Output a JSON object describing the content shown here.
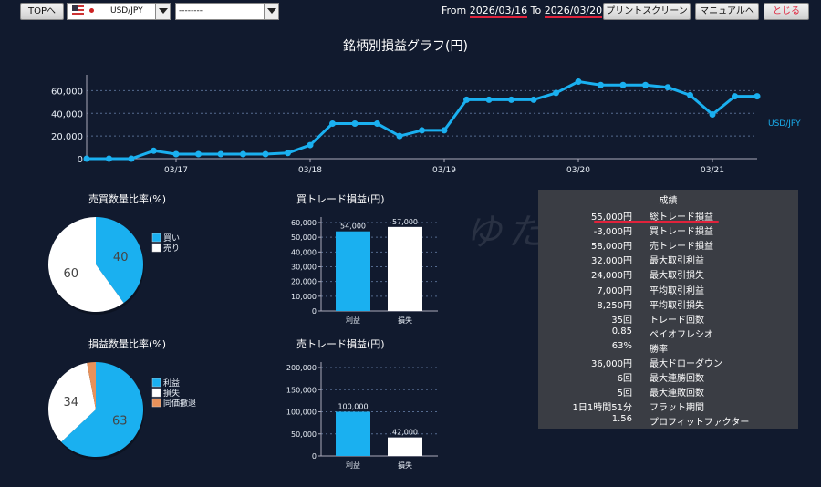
{
  "toolbar": {
    "top_label": "TOPへ",
    "pair_select": "USD/JPY",
    "second_select": "--------",
    "from_label": "From",
    "from_date": "2026/03/16",
    "to_label": "To",
    "to_date": "2026/03/20",
    "print_label": "プリントスクリーン",
    "manual_label": "マニュアルへ",
    "close_label": "とじる",
    "close_color": "#e0223b"
  },
  "watermark": "ゆたトーFX",
  "line_chart": {
    "title": "銘柄別損益グラフ(円)",
    "chart_data": {
      "type": "line",
      "series": [
        {
          "name": "USD/JPY",
          "color": "#1ab0f0",
          "values": [
            0,
            0,
            0,
            7000,
            4000,
            4000,
            4000,
            4000,
            4000,
            5000,
            12000,
            31000,
            31000,
            31000,
            20000,
            25000,
            25000,
            52000,
            52000,
            52000,
            52000,
            58000,
            68000,
            65000,
            65000,
            65000,
            63000,
            56000,
            39000,
            55000,
            55000
          ]
        }
      ],
      "x_ticks": [
        {
          "label": "03/17",
          "index": 4
        },
        {
          "label": "03/18",
          "index": 10
        },
        {
          "label": "03/19",
          "index": 16
        },
        {
          "label": "03/20",
          "index": 22
        },
        {
          "label": "03/21",
          "index": 28
        }
      ],
      "y_ticks": [
        "0",
        "20,000",
        "40,000",
        "60,000"
      ],
      "ylim": [
        0,
        70000
      ],
      "grid": true
    }
  },
  "pie_buysell": {
    "title": "売買数量比率(%)",
    "chart_data": {
      "type": "pie",
      "slices": [
        {
          "label": "買い",
          "value": 40,
          "color": "#1ab0f0"
        },
        {
          "label": "売り",
          "value": 60,
          "color": "#ffffff"
        }
      ]
    }
  },
  "pie_pl": {
    "title": "損益数量比率(%)",
    "chart_data": {
      "type": "pie",
      "slices": [
        {
          "label": "利益",
          "value": 63,
          "color": "#1ab0f0"
        },
        {
          "label": "損失",
          "value": 34,
          "color": "#ffffff"
        },
        {
          "label": "同価撤退",
          "value": 3,
          "color": "#e8915a"
        }
      ]
    }
  },
  "bar_buy": {
    "title": "買トレード損益(円)",
    "chart_data": {
      "type": "bar",
      "categories": [
        "利益",
        "損失"
      ],
      "values": [
        54000,
        57000
      ],
      "value_labels": [
        "54,000",
        "57,000"
      ],
      "colors": [
        "#1ab0f0",
        "#ffffff"
      ],
      "y_ticks": [
        "0",
        "10,000",
        "20,000",
        "30,000",
        "40,000",
        "50,000",
        "60,000"
      ],
      "ylim": [
        0,
        60000
      ]
    }
  },
  "bar_sell": {
    "title": "売トレード損益(円)",
    "chart_data": {
      "type": "bar",
      "categories": [
        "利益",
        "損失"
      ],
      "values": [
        100000,
        42000
      ],
      "value_labels": [
        "100,000",
        "42,000"
      ],
      "colors": [
        "#1ab0f0",
        "#ffffff"
      ],
      "y_ticks": [
        "0",
        "50,000",
        "100,000",
        "150,000",
        "200,000"
      ],
      "ylim": [
        0,
        200000
      ]
    }
  },
  "stats": {
    "header": "成績",
    "rows": [
      {
        "value": "55,000円",
        "label": "総トレード損益"
      },
      {
        "value": "-3,000円",
        "label": "買トレード損益"
      },
      {
        "value": "58,000円",
        "label": "売トレード損益"
      },
      {
        "value": "32,000円",
        "label": "最大取引利益"
      },
      {
        "value": "24,000円",
        "label": "最大取引損失"
      },
      {
        "value": "7,000円",
        "label": "平均取引利益"
      },
      {
        "value": "8,250円",
        "label": "平均取引損失"
      },
      {
        "value": "35回",
        "label": "トレード回数"
      },
      {
        "value": "0.85",
        "label": "ペイオフレシオ"
      },
      {
        "value": "63%",
        "label": "勝率"
      },
      {
        "value": "36,000円",
        "label": "最大ドローダウン"
      },
      {
        "value": "6回",
        "label": "最大連勝回数"
      },
      {
        "value": "5回",
        "label": "最大連敗回数"
      },
      {
        "value": "1日1時間51分",
        "label": "フラット期間"
      },
      {
        "value": "1.56",
        "label": "プロフィットファクター"
      }
    ]
  }
}
